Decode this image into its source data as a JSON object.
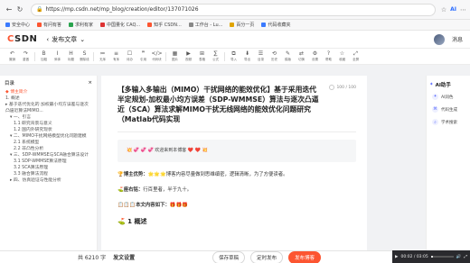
{
  "browser": {
    "url": "https://mp.csdn.net/mp_blog/creation/editor/137071026",
    "ai_label": "AI"
  },
  "bookmarks": [
    {
      "label": "安全中心",
      "color": "#3a7afe"
    },
    {
      "label": "有问有答",
      "color": "#fc5531"
    },
    {
      "label": "求利有家",
      "color": "#2aa44f"
    },
    {
      "label": "中国量化 CAQ...",
      "color": "#d33"
    },
    {
      "label": "知乎 CSDN...",
      "color": "#fc5531"
    },
    {
      "label": "工作台 - Lu...",
      "color": "#888"
    },
    {
      "label": "百分一页",
      "color": "#e0a400"
    },
    {
      "label": "代码收藏夹",
      "color": "#3a7afe"
    }
  ],
  "header": {
    "logo_prefix": "C",
    "logo_rest": "SDN",
    "title": "发布文章",
    "drafts": "消息"
  },
  "toolbar": [
    {
      "icon": "↶",
      "label": "撤销",
      "name": "undo"
    },
    {
      "icon": "↷",
      "label": "重做",
      "name": "redo"
    },
    {
      "icon": "B",
      "label": "加粗",
      "name": "bold"
    },
    {
      "icon": "I",
      "label": "斜体",
      "name": "italic"
    },
    {
      "icon": "H",
      "label": "标题",
      "name": "heading"
    },
    {
      "icon": "S",
      "label": "删除线",
      "name": "strikethrough"
    },
    {
      "icon": "≔",
      "label": "无序",
      "name": "unordered-list"
    },
    {
      "icon": "≡",
      "label": "有序",
      "name": "ordered-list"
    },
    {
      "icon": "☐",
      "label": "待办",
      "name": "todo"
    },
    {
      "icon": "❞",
      "label": "引用",
      "name": "quote"
    },
    {
      "icon": "</>",
      "label": "代码块",
      "name": "code-block"
    },
    {
      "icon": "▦",
      "label": "图片",
      "name": "image"
    },
    {
      "icon": "▶",
      "label": "视频",
      "name": "video"
    },
    {
      "icon": "⊞",
      "label": "表格",
      "name": "table"
    },
    {
      "icon": "∑",
      "label": "公式",
      "name": "formula"
    },
    {
      "icon": "⧉",
      "label": "导入",
      "name": "import"
    },
    {
      "icon": "⬇",
      "label": "导出",
      "name": "export"
    },
    {
      "icon": "☰",
      "label": "目录",
      "name": "toc"
    },
    {
      "icon": "⟲",
      "label": "历史",
      "name": "history"
    },
    {
      "icon": "✎",
      "label": "模版",
      "name": "template"
    },
    {
      "icon": "⇄",
      "label": "切换",
      "name": "switch"
    },
    {
      "icon": "⚙",
      "label": "设置",
      "name": "settings"
    },
    {
      "icon": "?",
      "label": "帮助",
      "name": "help"
    },
    {
      "icon": "☆",
      "label": "收藏",
      "name": "collect"
    },
    {
      "icon": "⤢",
      "label": "全屏",
      "name": "fullscreen"
    }
  ],
  "toc": {
    "title": "目录",
    "items": [
      {
        "text": "◆ 博主简介",
        "level": "l1",
        "active": true
      },
      {
        "text": "1. 概述",
        "level": "l1",
        "active": false
      },
      {
        "text": "▸ 基于迭代优化的 加权最小均方误差与逐次凸逼近算法MIMO...",
        "level": "l1",
        "active": false
      },
      {
        "text": "▾ 一、引言",
        "level": "l2",
        "active": false
      },
      {
        "text": "1.1 研究背景与意义",
        "level": "l3",
        "active": false
      },
      {
        "text": "1.2 国内外研究现状",
        "level": "l3",
        "active": false
      },
      {
        "text": "▾ 二、MIMO干扰网络模型优化问题建模",
        "level": "l2",
        "active": false
      },
      {
        "text": "2.1 系统模型",
        "level": "l3",
        "active": false
      },
      {
        "text": "2.2 非凸性分析",
        "level": "l3",
        "active": false
      },
      {
        "text": "▾ 三、SDP-WMMSE与SCA融合算法设计",
        "level": "l2",
        "active": false
      },
      {
        "text": "3.1 SDP-WMMSE算法原理",
        "level": "l3",
        "active": false
      },
      {
        "text": "3.2 SCA算法原理",
        "level": "l3",
        "active": false
      },
      {
        "text": "3.3 融合算法流程",
        "level": "l3",
        "active": false
      },
      {
        "text": "▸ 四、仿真验证与性能分析",
        "level": "l2",
        "active": false
      }
    ]
  },
  "editor": {
    "title": "【多输入多输出（MIMO）干扰网络的能效优化】基于采用迭代半定规划-加权最小均方误差（SDP-WMMSE）算法与逐次凸逼近（SCA）算法求解MIMO干扰无线网络的能效优化问题研究（Matlab代码实现",
    "word_count": "100 / 100",
    "welcome": "💥 💞 💞 💞 欢迎来到本博客 ❤️ ❤️ 💥",
    "intro_label": "🏆博主优势：",
    "intro_text": "🌟🌟🌟博客内容尽量做到思维缜密，逻辑清晰，为了方便读者。",
    "motto_label": "⛳️座右铭：",
    "motto_text": "行百里者，半于九十。",
    "contents_label": "📋📋📋本文内容如下：🎁🎁🎁",
    "section_heading": "⛳️ 1 概述"
  },
  "ai_panel": {
    "title": "AI助手",
    "items": [
      {
        "label": "AI润色",
        "icon": "✦",
        "name": "ai-polish"
      },
      {
        "label": "代码生成",
        "icon": "⌘",
        "name": "ai-code"
      },
      {
        "label": "学术搜索",
        "icon": "⌕",
        "name": "ai-search"
      }
    ]
  },
  "bottom": {
    "count": "共 6210 字",
    "settings": "发文设置",
    "save_draft": "保存草稿",
    "schedule": "定时发布",
    "publish": "发布博客",
    "player_time": "00:02 / 03:05",
    "player_progress": 0.08
  }
}
